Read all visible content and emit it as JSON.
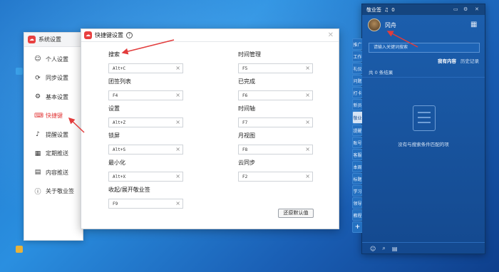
{
  "colors": {
    "accent": "#e23c3c",
    "panel_bg": "#1c5fae",
    "desktop": "#2a8fe0"
  },
  "settings": {
    "title": "系统设置",
    "items": [
      {
        "label": "个人设置",
        "icon": "user-icon"
      },
      {
        "label": "同步设置",
        "icon": "sync-icon"
      },
      {
        "label": "基本设置",
        "icon": "gear-icon"
      },
      {
        "label": "快捷键",
        "icon": "keyboard-icon",
        "active": true
      },
      {
        "label": "提醒设置",
        "icon": "bell-icon"
      },
      {
        "label": "定期推送",
        "icon": "calendar-icon"
      },
      {
        "label": "内容推送",
        "icon": "push-icon"
      },
      {
        "label": "关于敬业签",
        "icon": "info-icon"
      }
    ]
  },
  "dialog": {
    "title": "快捷键设置",
    "fields": [
      {
        "label": "搜索",
        "value": "Alt+C"
      },
      {
        "label": "时间管理",
        "value": "F5"
      },
      {
        "label": "团签列表",
        "value": "F4"
      },
      {
        "label": "已完成",
        "value": "F6"
      },
      {
        "label": "设置",
        "value": "Alt+Z"
      },
      {
        "label": "时间轴",
        "value": "F7"
      },
      {
        "label": "锁屏",
        "value": "Alt+S"
      },
      {
        "label": "月视图",
        "value": "F8"
      },
      {
        "label": "最小化",
        "value": "Alt+X"
      },
      {
        "label": "云同步",
        "value": "F2"
      },
      {
        "label": "收起/展开敬业签",
        "value": "F9"
      }
    ],
    "reset_label": "还原默认值"
  },
  "panel": {
    "title": "敬业签",
    "notification_count": "0",
    "username": "冈舟",
    "search_placeholder": "请输入关键词搜索",
    "tab_mine": "我有内容",
    "tab_history": "历史记录",
    "result_count": "共 0 条结果",
    "empty_text": "没有与搜索条件匹配的项",
    "vertical_tabs": [
      "推广",
      "工作",
      "礼仪",
      "问题",
      "打卡",
      "新员",
      "敬业",
      "提醒",
      "账号",
      "客服",
      "本周",
      "标题",
      "学习",
      "领导",
      "教程",
      "+"
    ]
  }
}
